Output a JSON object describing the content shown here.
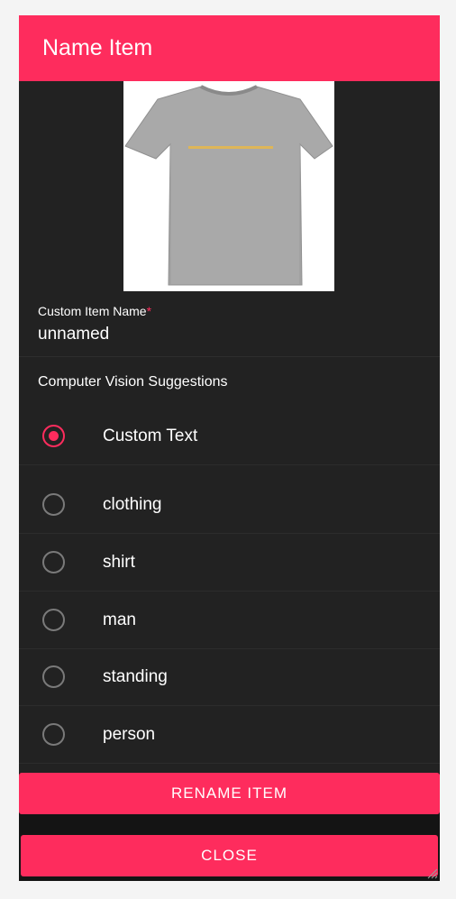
{
  "dialog": {
    "title": "Name Item",
    "image": {
      "alt": "grey t-shirt with yellow printed text",
      "shirt_color": "#a8a8a8",
      "print_color": "#e8b84a"
    },
    "custom_name": {
      "label": "Custom Item Name",
      "required_mark": "*",
      "value": "unnamed"
    },
    "suggestions_title": "Computer Vision Suggestions",
    "options": [
      {
        "label": "Custom Text",
        "checked": true
      },
      {
        "label": "clothing",
        "checked": false
      },
      {
        "label": "shirt",
        "checked": false
      },
      {
        "label": "man",
        "checked": false
      },
      {
        "label": "standing",
        "checked": false
      },
      {
        "label": "person",
        "checked": false
      }
    ],
    "rename_button": "RENAME ITEM",
    "close_button": "CLOSE"
  },
  "colors": {
    "accent": "#fe2c5d",
    "panel": "#222222",
    "footer": "#141414"
  }
}
